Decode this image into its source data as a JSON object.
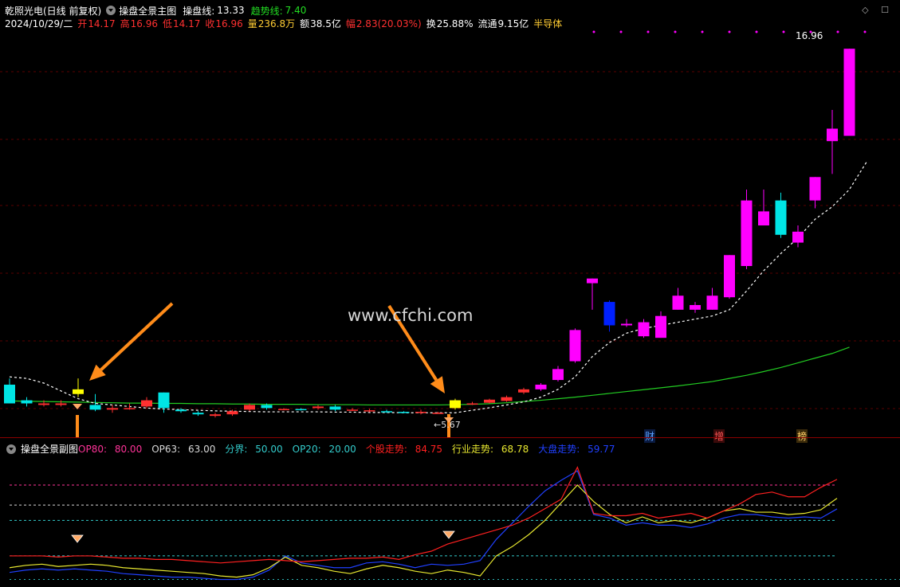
{
  "header": {
    "stock_name": "乾照光电(日线 前复权)",
    "main_indicator": "操盘全景主图",
    "operating_line_label": "操盘线:",
    "operating_line_value": "13.33",
    "trend_line_label": "趋势线:",
    "trend_line_value": "7.40",
    "right_icons": "◇ ☐"
  },
  "info": {
    "date": "2024/10/29/二",
    "open_label": "开",
    "open": "14.17",
    "high_label": "高",
    "high": "16.96",
    "low_label": "低",
    "low": "14.17",
    "close_label": "收",
    "close": "16.96",
    "volume_label": "量",
    "volume": "236.8万",
    "amount_label": "额",
    "amount": "38.5亿",
    "change_label": "幅",
    "change": "2.83(20.03%)",
    "turnover_label": "换",
    "turnover": "25.88%",
    "float_label": "流通",
    "float": "9.15亿",
    "sector": "半导体"
  },
  "annotations": {
    "watermark": "www.cfchi.com",
    "last_price": "16.96",
    "low_price": "←5.67",
    "tags": [
      "财",
      "增",
      "榜"
    ]
  },
  "sub": {
    "title": "操盘全景副图",
    "op80_label": "OP80:",
    "op80": "80.00",
    "op63_label": "OP63:",
    "op63": "63.00",
    "boundary_label": "分界:",
    "boundary": "50.00",
    "op20_label": "OP20:",
    "op20": "20.00",
    "stock_trend_label": "个股走势:",
    "stock_trend": "84.75",
    "industry_trend_label": "行业走势:",
    "industry_trend": "68.78",
    "market_trend_label": "大盘走势:",
    "market_trend": "59.77"
  },
  "colors": {
    "up": "#ff3030",
    "down": "#00e5e5",
    "magenta": "#ff00ff",
    "blue": "#0020ff",
    "yellow": "#ffff00",
    "green": "#22cc22",
    "orange": "#ff8c1a",
    "stock_line": "#ff2020",
    "industry_line": "#e8e830",
    "market_line": "#2040ff",
    "op80": "#ff3399",
    "op63": "#d8d8d8",
    "boundary": "#33cccc",
    "op20": "#33cccc"
  },
  "chart_data": {
    "type": "candlestick",
    "price_range": [
      5.0,
      17.5
    ],
    "candles": [
      {
        "o": 5.6,
        "c": 6.2,
        "h": 6.4,
        "l": 5.6,
        "color": "cyan"
      },
      {
        "o": 5.7,
        "c": 5.6,
        "h": 5.8,
        "l": 5.5,
        "color": "cyan"
      },
      {
        "o": 5.55,
        "c": 5.6,
        "h": 5.7,
        "l": 5.5,
        "color": "red"
      },
      {
        "o": 5.55,
        "c": 5.6,
        "h": 5.7,
        "l": 5.5,
        "color": "red"
      },
      {
        "o": 5.9,
        "c": 6.05,
        "h": 6.4,
        "l": 5.8,
        "color": "yellow"
      },
      {
        "o": 5.55,
        "c": 5.4,
        "h": 5.9,
        "l": 5.35,
        "color": "cyan"
      },
      {
        "o": 5.45,
        "c": 5.4,
        "h": 5.55,
        "l": 5.3,
        "color": "red"
      },
      {
        "o": 5.45,
        "c": 5.45,
        "h": 5.6,
        "l": 5.4,
        "color": "red"
      },
      {
        "o": 5.5,
        "c": 5.7,
        "h": 5.8,
        "l": 5.45,
        "color": "red"
      },
      {
        "o": 5.95,
        "c": 5.45,
        "h": 5.95,
        "l": 5.3,
        "color": "cyan"
      },
      {
        "o": 5.4,
        "c": 5.35,
        "h": 5.45,
        "l": 5.3,
        "color": "cyan"
      },
      {
        "o": 5.3,
        "c": 5.25,
        "h": 5.35,
        "l": 5.2,
        "color": "cyan"
      },
      {
        "o": 5.25,
        "c": 5.2,
        "h": 5.3,
        "l": 5.15,
        "color": "red"
      },
      {
        "o": 5.25,
        "c": 5.35,
        "h": 5.4,
        "l": 5.2,
        "color": "red"
      },
      {
        "o": 5.4,
        "c": 5.55,
        "h": 5.6,
        "l": 5.35,
        "color": "red"
      },
      {
        "o": 5.55,
        "c": 5.45,
        "h": 5.6,
        "l": 5.4,
        "color": "cyan"
      },
      {
        "o": 5.42,
        "c": 5.4,
        "h": 5.45,
        "l": 5.38,
        "color": "red"
      },
      {
        "o": 5.4,
        "c": 5.42,
        "h": 5.45,
        "l": 5.37,
        "color": "cyan"
      },
      {
        "o": 5.45,
        "c": 5.5,
        "h": 5.55,
        "l": 5.4,
        "color": "red"
      },
      {
        "o": 5.5,
        "c": 5.4,
        "h": 5.55,
        "l": 5.35,
        "color": "cyan"
      },
      {
        "o": 5.4,
        "c": 5.38,
        "h": 5.45,
        "l": 5.35,
        "color": "red"
      },
      {
        "o": 5.38,
        "c": 5.35,
        "h": 5.42,
        "l": 5.32,
        "color": "red"
      },
      {
        "o": 5.35,
        "c": 5.33,
        "h": 5.4,
        "l": 5.3,
        "color": "cyan"
      },
      {
        "o": 5.33,
        "c": 5.32,
        "h": 5.35,
        "l": 5.3,
        "color": "cyan"
      },
      {
        "o": 5.3,
        "c": 5.33,
        "h": 5.4,
        "l": 5.25,
        "color": "red"
      },
      {
        "o": 5.3,
        "c": 5.3,
        "h": 5.33,
        "l": 5.27,
        "color": "red"
      },
      {
        "o": 5.45,
        "c": 5.7,
        "h": 5.75,
        "l": 5.4,
        "color": "yellow"
      },
      {
        "o": 5.6,
        "c": 5.6,
        "h": 5.65,
        "l": 5.55,
        "color": "red"
      },
      {
        "o": 5.62,
        "c": 5.72,
        "h": 5.75,
        "l": 5.6,
        "color": "red"
      },
      {
        "o": 5.68,
        "c": 5.8,
        "h": 5.85,
        "l": 5.65,
        "color": "red"
      },
      {
        "o": 5.95,
        "c": 6.05,
        "h": 6.1,
        "l": 5.9,
        "color": "red"
      },
      {
        "o": 6.05,
        "c": 6.2,
        "h": 6.25,
        "l": 6.0,
        "color": "magenta"
      },
      {
        "o": 6.35,
        "c": 6.7,
        "h": 6.8,
        "l": 6.3,
        "color": "magenta"
      },
      {
        "o": 6.95,
        "c": 7.95,
        "h": 8.0,
        "l": 6.9,
        "color": "magenta"
      },
      {
        "o": 9.6,
        "c": 9.45,
        "h": 9.6,
        "l": 8.6,
        "color": "magenta"
      },
      {
        "o": 8.85,
        "c": 8.1,
        "h": 8.9,
        "l": 7.9,
        "color": "blue"
      },
      {
        "o": 8.15,
        "c": 8.1,
        "h": 8.3,
        "l": 8.05,
        "color": "magenta"
      },
      {
        "o": 7.75,
        "c": 8.2,
        "h": 8.3,
        "l": 7.7,
        "color": "magenta"
      },
      {
        "o": 7.7,
        "c": 8.4,
        "h": 8.55,
        "l": 7.7,
        "color": "magenta"
      },
      {
        "o": 8.6,
        "c": 9.05,
        "h": 9.3,
        "l": 8.6,
        "color": "magenta"
      },
      {
        "o": 8.6,
        "c": 8.75,
        "h": 8.85,
        "l": 8.5,
        "color": "magenta"
      },
      {
        "o": 8.6,
        "c": 9.05,
        "h": 9.3,
        "l": 8.6,
        "color": "magenta"
      },
      {
        "o": 9.0,
        "c": 10.35,
        "h": 10.35,
        "l": 8.95,
        "color": "magenta"
      },
      {
        "o": 10.0,
        "c": 12.1,
        "h": 12.45,
        "l": 9.9,
        "color": "magenta"
      },
      {
        "o": 11.3,
        "c": 11.75,
        "h": 12.45,
        "l": 11.3,
        "color": "magenta"
      },
      {
        "o": 11.0,
        "c": 12.1,
        "h": 12.35,
        "l": 10.9,
        "color": "cyan"
      },
      {
        "o": 11.1,
        "c": 10.75,
        "h": 11.3,
        "l": 10.6,
        "color": "magenta"
      },
      {
        "o": 12.1,
        "c": 12.85,
        "h": 12.85,
        "l": 11.85,
        "color": "magenta"
      },
      {
        "o": 14.0,
        "c": 14.4,
        "h": 15.0,
        "l": 12.95,
        "color": "magenta"
      },
      {
        "o": 14.17,
        "c": 16.96,
        "h": 16.96,
        "l": 14.17,
        "color": "magenta"
      }
    ],
    "operating_line": [
      6.45,
      6.4,
      6.25,
      6.0,
      5.75,
      5.6,
      5.55,
      5.5,
      5.45,
      5.42,
      5.4,
      5.38,
      5.36,
      5.35,
      5.34,
      5.33,
      5.33,
      5.33,
      5.33,
      5.32,
      5.32,
      5.31,
      5.31,
      5.3,
      5.3,
      5.3,
      5.3,
      5.38,
      5.46,
      5.55,
      5.65,
      5.8,
      6.05,
      6.45,
      7.1,
      7.55,
      7.85,
      8.0,
      8.1,
      8.2,
      8.3,
      8.4,
      8.6,
      9.2,
      9.85,
      10.4,
      10.9,
      11.5,
      11.9,
      12.45,
      13.33
    ],
    "trend_line": [
      5.68,
      5.67,
      5.66,
      5.65,
      5.64,
      5.63,
      5.62,
      5.61,
      5.61,
      5.6,
      5.6,
      5.59,
      5.59,
      5.58,
      5.58,
      5.57,
      5.57,
      5.57,
      5.56,
      5.56,
      5.56,
      5.55,
      5.55,
      5.55,
      5.55,
      5.55,
      5.56,
      5.57,
      5.59,
      5.62,
      5.66,
      5.7,
      5.75,
      5.8,
      5.86,
      5.92,
      5.98,
      6.04,
      6.1,
      6.16,
      6.23,
      6.3,
      6.4,
      6.5,
      6.62,
      6.75,
      6.9,
      7.05,
      7.2,
      7.4
    ],
    "sub_levels": {
      "op80": 80,
      "op63": 63,
      "boundary": 50,
      "op20": 20
    },
    "sub_range": [
      -5,
      113
    ],
    "stock_trend": [
      20,
      20,
      20,
      19,
      20,
      20,
      19,
      18,
      18,
      17,
      17,
      16,
      15,
      14,
      15,
      16,
      17,
      16,
      15,
      16,
      17,
      18,
      18,
      19,
      17,
      21,
      24,
      30,
      34,
      38,
      42,
      46,
      52,
      60,
      68,
      95,
      56,
      54,
      54,
      56,
      52,
      54,
      56,
      52,
      58,
      64,
      72,
      74,
      70,
      70,
      78,
      84.75
    ],
    "industry_trend": [
      10,
      12,
      13,
      11,
      12,
      13,
      12,
      10,
      9,
      8,
      7,
      6,
      5,
      3,
      2,
      4,
      10,
      19,
      12,
      10,
      7,
      5,
      9,
      12,
      10,
      7,
      5,
      8,
      6,
      3,
      20,
      28,
      38,
      50,
      65,
      80,
      66,
      55,
      48,
      53,
      48,
      50,
      48,
      52,
      58,
      60,
      57,
      57,
      55,
      56,
      59,
      68.78
    ],
    "market_trend": [
      6,
      8,
      9,
      8,
      9,
      8,
      7,
      5,
      4,
      3,
      2,
      2,
      1,
      0,
      0,
      2,
      8,
      20,
      14,
      12,
      10,
      10,
      14,
      15,
      13,
      10,
      13,
      12,
      13,
      16,
      34,
      48,
      62,
      75,
      84,
      92,
      55,
      52,
      46,
      48,
      46,
      46,
      44,
      47,
      52,
      55,
      55,
      53,
      52,
      53,
      52,
      59.77
    ]
  }
}
